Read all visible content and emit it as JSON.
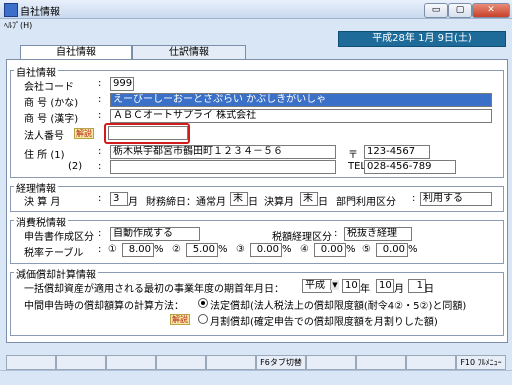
{
  "window": {
    "title": "自社情報",
    "minimize_glyph": "▭",
    "maximize_glyph": "▢",
    "close_glyph": "✕"
  },
  "menu": {
    "help": "ﾍﾙﾌﾟ(H)"
  },
  "tabs": [
    {
      "label": "自社情報",
      "active": true
    },
    {
      "label": "仕訳情報",
      "active": false
    }
  ],
  "date_display": "平成28年 1月 9日(土)",
  "company": {
    "section_title": "自社情報",
    "code_label": "会社コード",
    "code_value": "999",
    "kana_label": "商 号 (かな)",
    "kana_value": "えーびーしーおーとさぷらい かぶしきがいしゃ",
    "kanji_label": "商 号 (漢字)",
    "kanji_value": "ＡＢＣオートサプライ 株式会社",
    "corp_number_label": "法人番号",
    "corp_number_value": "",
    "help_badge": "解説",
    "address1_label": "住 所 (1)",
    "address1_value": "栃木県宇都宮市鶴田町１２３４－５６",
    "address2_label": "(2)",
    "address2_value": "",
    "zip_mark": "〒",
    "zip_value": "123-4567",
    "tel_label": "TEL",
    "tel_value": "028-456-789"
  },
  "fiscal": {
    "section_title": "経理情報",
    "month_label": "決 算 月",
    "month_value": "3",
    "month_unit": "月",
    "close_label": "財務締日：通常月",
    "close_value": "末",
    "day_unit": "日",
    "settle_label": "決算月",
    "settle_value": "末",
    "dept_label": "部門利用区分",
    "dept_value": "利用する"
  },
  "tax": {
    "section_title": "消費税情報",
    "doc_label": "申告書作成区分",
    "doc_value": "自動作成する",
    "method_label": "税額経理区分",
    "method_value": "税抜き経理",
    "rate_label": "税率テーブル",
    "rates": [
      {
        "num": "①",
        "value": "8.00",
        "unit": "%"
      },
      {
        "num": "②",
        "value": "5.00",
        "unit": "%"
      },
      {
        "num": "③",
        "value": "0.00",
        "unit": "%"
      },
      {
        "num": "④",
        "value": "0.00",
        "unit": "%"
      },
      {
        "num": "⑤",
        "value": "0.00",
        "unit": "%"
      }
    ]
  },
  "depreciation": {
    "section_title": "減価償却計算情報",
    "start_label": "一括償却資産が適用される最初の事業年度の期首年月日：",
    "era_value": "平成",
    "year_value": "10",
    "year_unit": "年",
    "month_value": "10",
    "month_unit": "月",
    "day_value": "1",
    "day_unit": "日",
    "method_label": "中間申告時の償却額算の計算方法：",
    "option1": "法定償却(法人税法上の償却限度額(耐令4②・5②)と同額)",
    "option2": "月割償却(確定申告での償却限度額を月割りした額)"
  },
  "fkeys": [
    "",
    "",
    "",
    "",
    "",
    "F6タブ切替",
    "",
    "",
    "",
    "F10 ﾌﾙﾒﾆｭｰ"
  ]
}
